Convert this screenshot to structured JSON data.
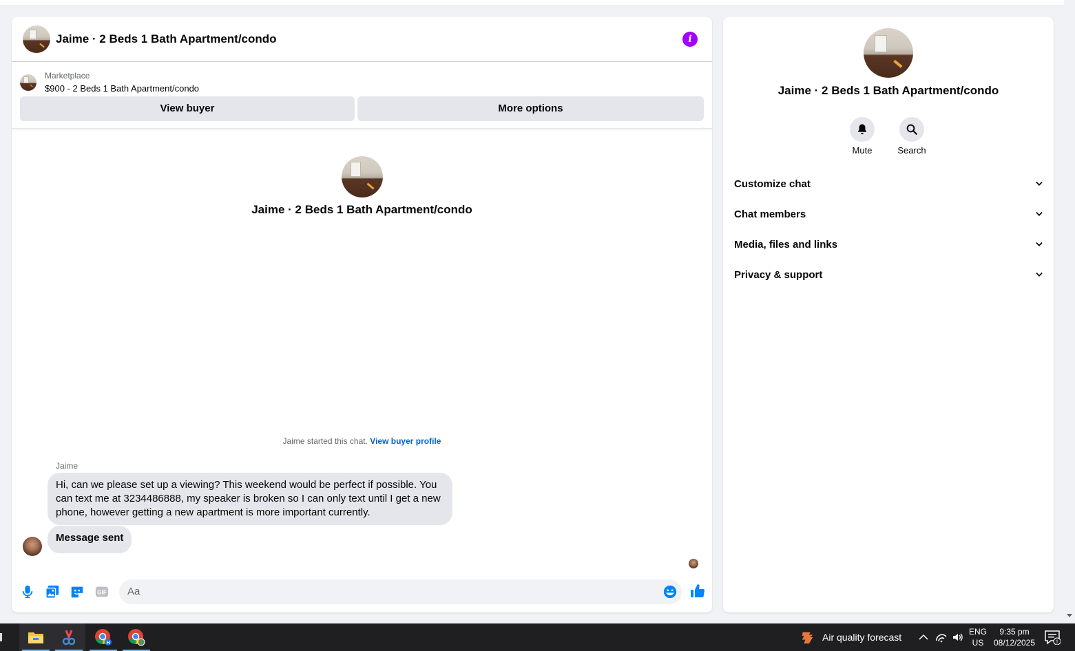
{
  "chat": {
    "title": "Jaime · 2 Beds 1 Bath Apartment/condo",
    "marketplace_label": "Marketplace",
    "listing": "$900 - 2 Beds 1 Bath Apartment/condo",
    "view_buyer_label": "View buyer",
    "more_options_label": "More options",
    "profile_name": "Jaime · 2 Beds 1 Bath Apartment/condo",
    "started_text": "Jaime started this chat.",
    "view_profile_link": "View buyer profile",
    "messages": [
      {
        "sender": "Jaime",
        "text": "Hi, can we please set up a viewing? This weekend would be perfect if possible.  You can text me at 3234486888,  my speaker is broken so I can only text until I get a new phone, however getting a new apartment is more important currently."
      },
      {
        "text": "Message sent"
      }
    ],
    "composer_placeholder": "Aa"
  },
  "side": {
    "name": "Jaime · 2 Beds 1 Bath Apartment/condo",
    "mute_label": "Mute",
    "search_label": "Search",
    "sections": [
      "Customize chat",
      "Chat members",
      "Media, files and links",
      "Privacy & support"
    ]
  },
  "taskbar": {
    "weather": "Air quality forecast",
    "lang_1": "ENG",
    "lang_2": "US",
    "time": "9:35 pm",
    "date": "08/12/2025",
    "notification_count": "1"
  },
  "colors": {
    "accent": "#0084ff",
    "info": "#a200ff",
    "link": "#0064d1"
  }
}
